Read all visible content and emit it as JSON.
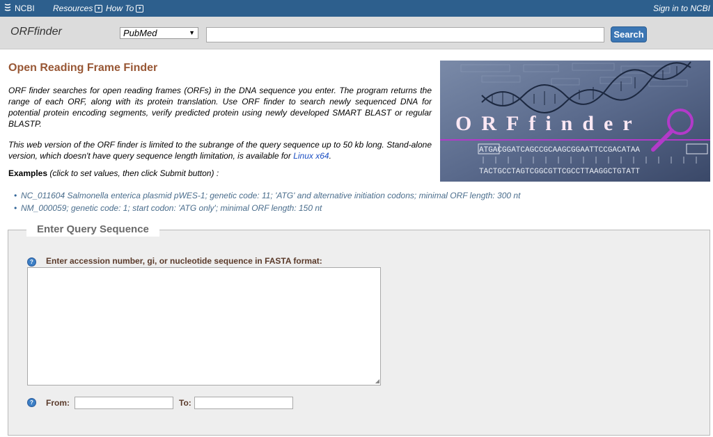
{
  "topbar": {
    "logo_text": "NCBI",
    "resources_label": "Resources",
    "howto_label": "How To",
    "signin_label": "Sign in to NCBI"
  },
  "searchbar": {
    "app_name": "ORFfinder",
    "db_selected": "PubMed",
    "search_value": "",
    "search_button": "Search"
  },
  "main": {
    "title": "Open Reading Frame Finder",
    "intro": "ORF finder searches for open reading frames (ORFs) in the DNA sequence you enter. The program returns the range of each ORF, along with its protein translation. Use ORF finder to search newly sequenced DNA for potential protein encoding segments, verify predicted protein using newly developed SMART BLAST or regular BLASTP.",
    "limit_text": "This web version of the ORF finder is limited to the subrange of the query sequence up to 50 kb long. Stand-alone version, which doesn't have query sequence length limitation, is available for",
    "linux_link": "Linux x64",
    "limit_end": ".",
    "examples_label": "Examples",
    "examples_hint": " (click to set values, then click Submit button) :",
    "examples": [
      "NC_011604 Salmonella enterica plasmid pWES-1; genetic code: 11; 'ATG' and alternative initiation codons; minimal ORF length: 300 nt",
      "NM_000059; genetic code: 1; start codon: 'ATG only'; minimal ORF length: 150 nt"
    ]
  },
  "banner": {
    "logo_text": "ORFfinder",
    "seq_top": "ATGACGGATCAGCCGCAAGCGGAATTCCGACATAA",
    "seq_bottom": "TACTGCCTAGTCGGCGTTCGCCTTAAGGCTGTATT"
  },
  "query": {
    "legend": "Enter Query Sequence",
    "seq_label": "Enter accession number, gi, or nucleotide sequence in FASTA format:",
    "seq_value": "",
    "from_label": "From:",
    "to_label": "To:",
    "from_value": "",
    "to_value": ""
  },
  "colors": {
    "topbar": "#2d5f8d",
    "title": "#985735",
    "button": "#3b76b4",
    "banner_accent": "#b23ac9"
  }
}
